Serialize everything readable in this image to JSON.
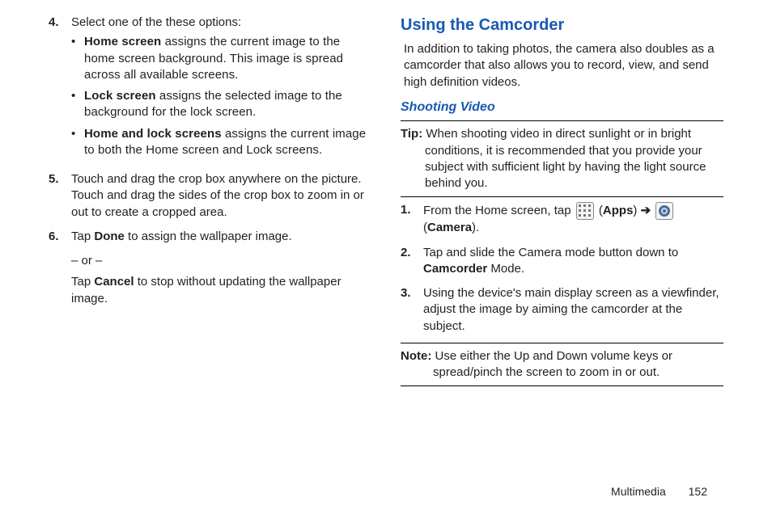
{
  "left": {
    "step4": {
      "num": "4.",
      "lead": "Select one of the these options:",
      "bullets": [
        {
          "bold": "Home screen",
          "rest": " assigns the current image to the home screen background. This image is spread across all available screens."
        },
        {
          "bold": "Lock screen",
          "rest": " assigns the selected image to the background for the lock screen."
        },
        {
          "bold": "Home and lock screens",
          "rest": " assigns the current image to both the Home screen and Lock screens."
        }
      ]
    },
    "step5": {
      "num": "5.",
      "text": "Touch and drag the crop box anywhere on the picture. Touch and drag the sides of the crop box to zoom in or out to create a cropped area."
    },
    "step6": {
      "num": "6.",
      "pre": "Tap ",
      "bold1": "Done",
      "post1": " to assign the wallpaper image.",
      "or": "– or –",
      "pre2": "Tap ",
      "bold2": "Cancel",
      "post2": " to stop without updating the wallpaper image."
    }
  },
  "right": {
    "heading": "Using the Camcorder",
    "intro": "In addition to taking photos, the camera also doubles as a camcorder that also allows you to record, view, and send high definition videos.",
    "subheading": "Shooting Video",
    "tip": {
      "lead": "Tip:",
      "text": " When shooting video in direct sunlight or in bright conditions, it is recommended that you provide your subject with sufficient light by having the light source behind you."
    },
    "steps": {
      "s1": {
        "num": "1.",
        "pre": "From the Home screen, tap ",
        "apps": "Apps",
        "arrow": " ➔ ",
        "camera": "Camera",
        "post": "."
      },
      "s2": {
        "num": "2.",
        "pre": "Tap and slide the Camera mode button down to ",
        "bold": "Camcorder",
        "post": " Mode."
      },
      "s3": {
        "num": "3.",
        "text": "Using the device's main display screen as a viewfinder, adjust the image by aiming the camcorder at the subject."
      }
    },
    "note": {
      "lead": "Note:",
      "text": " Use either the Up and Down volume keys or spread/pinch the screen to zoom in or out."
    }
  },
  "footer": {
    "section": "Multimedia",
    "page": "152"
  }
}
